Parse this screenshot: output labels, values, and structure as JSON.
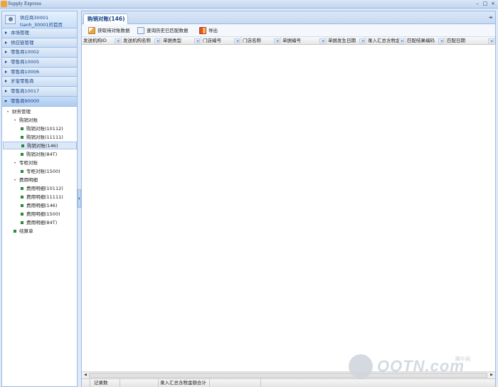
{
  "window": {
    "title": "Supply Express"
  },
  "user": {
    "line1": "供应商30001",
    "line2": "tianh_30001的首页"
  },
  "accordion": [
    {
      "label": "本场管理",
      "open": false
    },
    {
      "label": "供应链管理",
      "open": false
    },
    {
      "label": "零售商10002",
      "open": false
    },
    {
      "label": "零售商10005",
      "open": false
    },
    {
      "label": "零售商10006",
      "open": false
    },
    {
      "label": "岁宝零售商",
      "open": false
    },
    {
      "label": "零售商10017",
      "open": false
    },
    {
      "label": "零售商90000",
      "open": true
    }
  ],
  "tree": {
    "root": "财务管理",
    "group1": "购销对账",
    "g1_items": [
      "购销对账(10112)",
      "购销对账(11111)",
      "购销对账(146)",
      "购销对账(84T)"
    ],
    "group2": "专柜对账",
    "g2_items": [
      "专柜对账(1500)"
    ],
    "group3": "费用明细",
    "g3_items": [
      "费用明细(10112)",
      "费用明细(11111)",
      "费用明细(146)",
      "费用明细(1500)",
      "费用明细(84T)"
    ],
    "settlement": "结算单",
    "selected": "购销对账(146)"
  },
  "tab": {
    "label": "购销对账(146)"
  },
  "toolbar": {
    "fetch": "获取待对账数据",
    "history": "查询历史已匹配数据",
    "export": "导出"
  },
  "columns": [
    "发送机构ID",
    "发送机构名称",
    "单据类型",
    "门店编号",
    "门店名称",
    "单据编号",
    "单据发生日期",
    "录入汇总含税金",
    "匹配结果编码",
    "匹配日期"
  ],
  "status": {
    "record_count": "记录数",
    "sum_label": "录入汇总含税金额合计"
  },
  "watermark": {
    "brand": "QQTN.com",
    "cn": "腾牛网"
  },
  "icons": {
    "fetch": "fetch-data-icon",
    "history": "history-search-icon",
    "export": "export-icon",
    "avatar": "user-avatar-icon"
  },
  "colors": {
    "accent": "#15428b",
    "border": "#99bbe8",
    "leaf": "#35a24d"
  }
}
